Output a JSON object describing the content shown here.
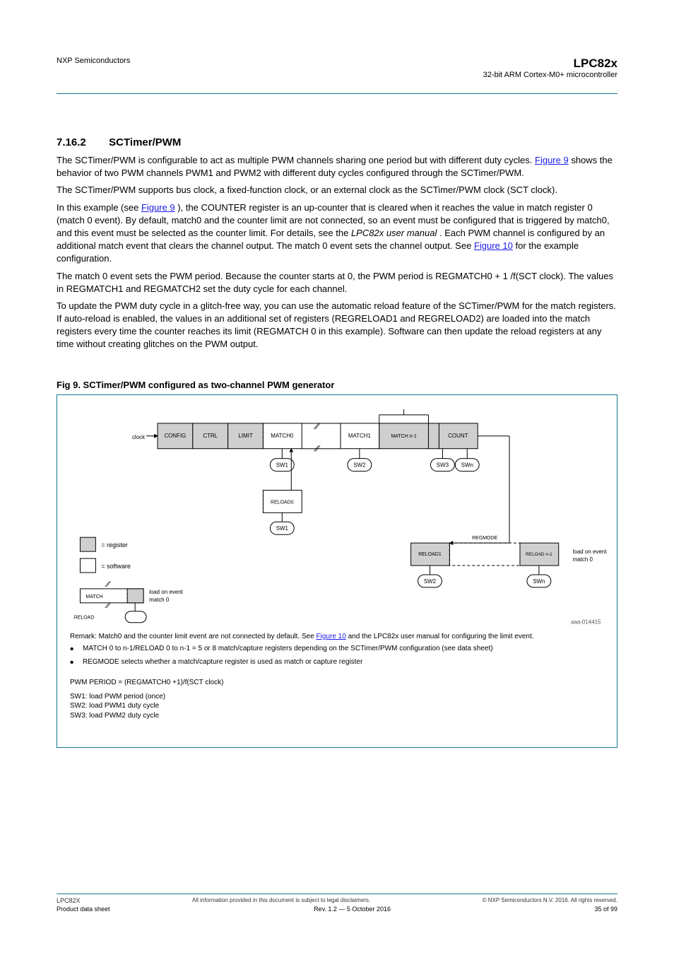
{
  "header": {
    "left": "NXP Semiconductors",
    "right_line1": "LPC82x",
    "right_line2": "32-bit ARM Cortex-M0+ microcontroller"
  },
  "section": {
    "number": "7.16.2",
    "title": "SCTimer/PWM"
  },
  "paragraphs": {
    "p1_a": "The SCTimer/PWM is configurable to act as multiple PWM channels sharing one period but with different duty cycles. ",
    "p1_link": "Figure 9",
    "p1_b": " shows the behavior of two PWM channels PWM1 and PWM2 with different duty cycles configured through the SCTimer/PWM.",
    "p2": "The SCTimer/PWM supports bus clock, a fixed-function clock, or an external clock as the SCTimer/PWM clock (SCT clock).",
    "p3_a": "In this example (see ",
    "p3_link": "Figure 9",
    "p3_b": "), the COUNTER register is an up-counter that is cleared when it reaches the value in match register 0 (match 0 event). By default, match0 and the counter limit are not connected, so an event must be configured that is triggered by match0, and this event must be selected as the counter limit. For details, see the ",
    "p3_link2": "LPC82x user manual",
    "p3_c": ". Each PWM channel is configured by an additional match event that clears the channel output. The match 0 event sets the channel output. See ",
    "p3_link3": "Figure 10",
    "p3_d": " for the example configuration.",
    "p4_a": "The match 0 event sets the PWM period. Because the counter starts at 0, the PWM period is REGMATCH0",
    "p4_sub": "+ 1",
    "p4_b": "/f(SCT clock). The values in REGMATCH1 and REGMATCH2 set the duty cycle for each channel.",
    "p5_a": "To update the PWM duty cycle in a glitch-free way, you can use the automatic reload feature of the SCTimer/PWM for the match registers. If auto-reload is enabled, the values in an additional set of registers (REGRELOAD1 and REGRELOAD2) are loaded into the match registers every time the counter reaches its limit (REGMATCH",
    "p5_sub": "0",
    "p5_b": " in this example). Software can then update the reload registers at any time without creating glitches on the PWM output."
  },
  "figure": {
    "caption": "Fig 9.    SCTimer/PWM configured as two-channel PWM generator",
    "note_label": "Remark:",
    "note_text_a": "Match0 and the counter limit event are not connected by default. See ",
    "note_link": "Figure 10",
    "note_text_b": " and the LPC82x user manual for configuring the limit event.",
    "legend_reg": "= register",
    "legend_sw": "= software",
    "legend_load_top": "load on event",
    "legend_load_bot": "match 0",
    "legend_rel": "RELOAD",
    "legend_match": "MATCH",
    "pwm_period": "PWM PERIOD = (REGMATCH0 +1)/f(SCT clock)",
    "sw_labels": [
      "SW1: load PWM period (once)",
      "SW2: load PWM1 duty cycle",
      "SW3: load PWM2 duty cycle"
    ],
    "regs": {
      "config": "CONFIG",
      "ctrl": "CTRL",
      "limit": "LIMIT",
      "match0": "MATCH0",
      "match1": "MATCH1",
      "matchn": "MATCH   n-1",
      "count": "COUNT",
      "reload0": "RELOAD0",
      "reload1": "RELOAD1",
      "reloadn_1": "RELOAD   n-1",
      "regmode": "REGMODE"
    },
    "sw_boxes": {
      "sw1": "SW1",
      "sw2": "SW2",
      "sw3": "SW3",
      "swn": "SWn"
    },
    "annot": {
      "load_match0_a": "load on event",
      "load_match0_b": "match 0"
    },
    "clock_label": "clock",
    "diagram_id": "aaa-014415",
    "bullets": [
      "MATCH 0 to n-1/RELOAD 0 to n-1 = 5 or 8 match/capture registers depending on the SCTimer/PWM configuration (see data sheet)",
      "REGMODE selects whether a match/capture register is used as match or capture register"
    ]
  },
  "footer": {
    "left_doc": "LPC82X",
    "mid": "All information provided in this document is subject to legal disclaimers.",
    "right": "© NXP Semiconductors N.V. 2016. All rights reserved.",
    "bl_label": "Product data sheet",
    "bl_rev": "Rev. 1.2 — 5 October 2016",
    "br": "35 of 99"
  },
  "chart_data": {
    "type": "diagram",
    "description": "Block diagram of SCTimer/PWM registers with reload path; not a quantitative chart."
  }
}
